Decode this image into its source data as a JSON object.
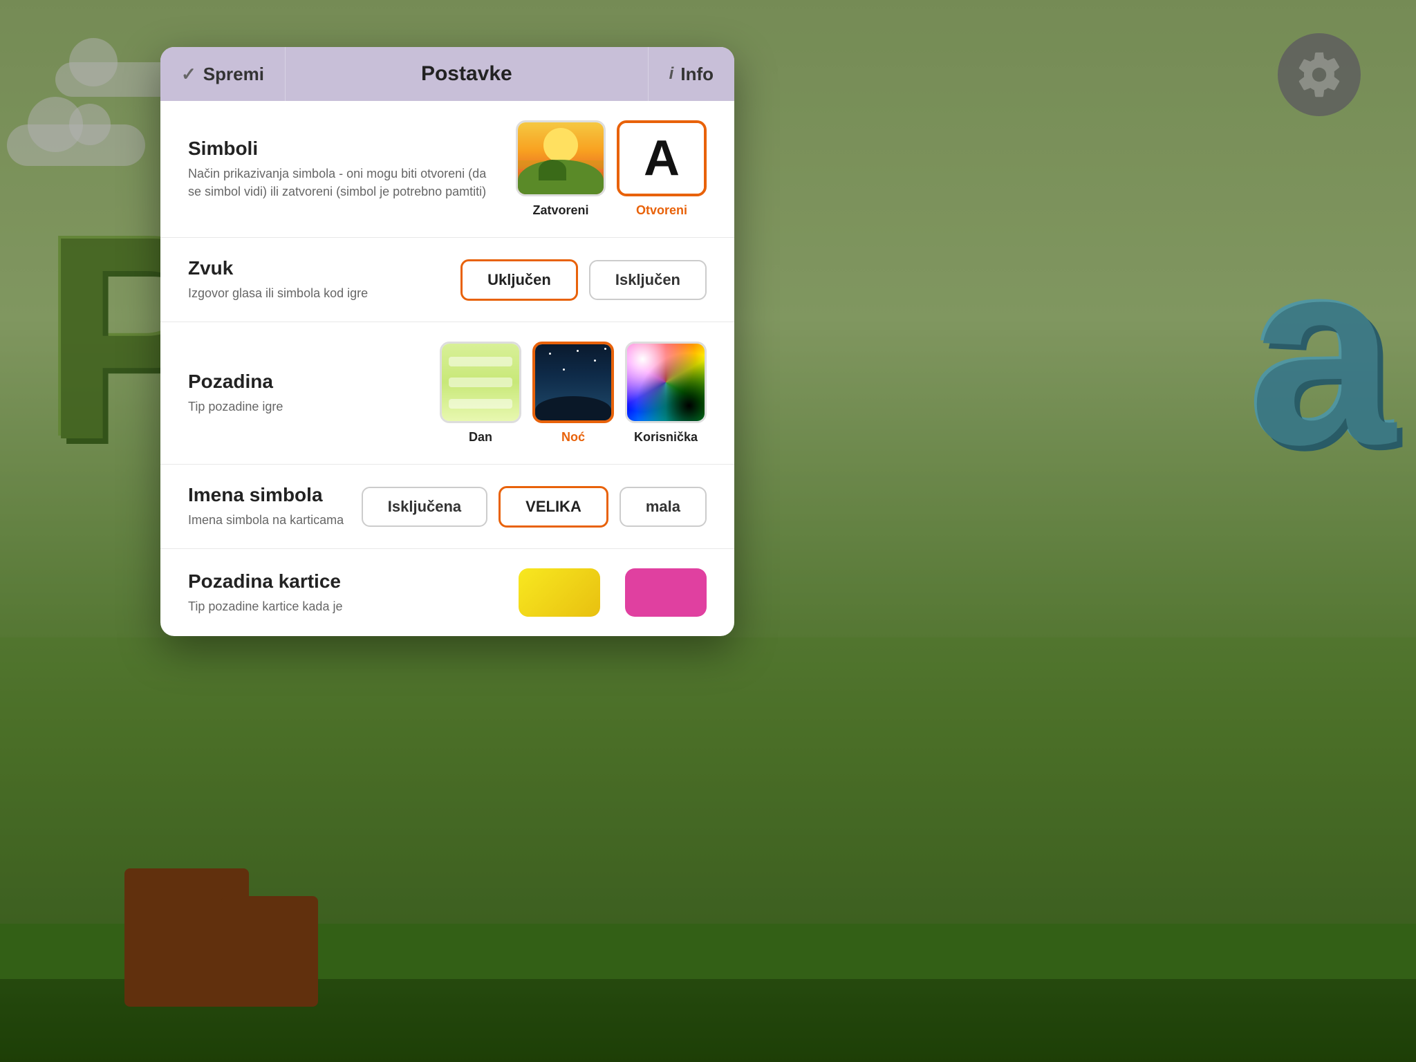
{
  "background": {
    "letters": {
      "p_letter": "P",
      "a_letter": "a"
    }
  },
  "gear_button": {
    "label": "settings"
  },
  "dialog": {
    "header": {
      "save_label": "Spremi",
      "title": "Postavke",
      "info_label": "Info"
    },
    "sections": [
      {
        "id": "simboli",
        "title": "Simboli",
        "desc": "Način prikazivanja simbola - oni mogu biti otvoreni (da se simbol vidi) ili zatvoreni (simbol je potrebno pamtiti)",
        "options": [
          {
            "label": "Zatvoreni",
            "selected": false
          },
          {
            "label": "Otvoreni",
            "selected": true
          }
        ]
      },
      {
        "id": "zvuk",
        "title": "Zvuk",
        "desc": "Izgovor glasa ili simbola kod igre",
        "options": [
          {
            "label": "Uključen",
            "selected": true
          },
          {
            "label": "Isključen",
            "selected": false
          }
        ]
      },
      {
        "id": "pozadina",
        "title": "Pozadina",
        "desc": "Tip pozadine igre",
        "options": [
          {
            "label": "Dan",
            "selected": false
          },
          {
            "label": "Noć",
            "selected": true
          },
          {
            "label": "Korisnička",
            "selected": false
          }
        ]
      },
      {
        "id": "imena-simbola",
        "title": "Imena simbola",
        "desc": "Imena simbola na karticama",
        "options": [
          {
            "label": "Isključena",
            "selected": false
          },
          {
            "label": "VELIKA",
            "selected": true
          },
          {
            "label": "mala",
            "selected": false
          }
        ]
      },
      {
        "id": "pozadina-kartice",
        "title": "Pozadina kartice",
        "desc": "Tip pozadine kartice kada je"
      }
    ]
  }
}
